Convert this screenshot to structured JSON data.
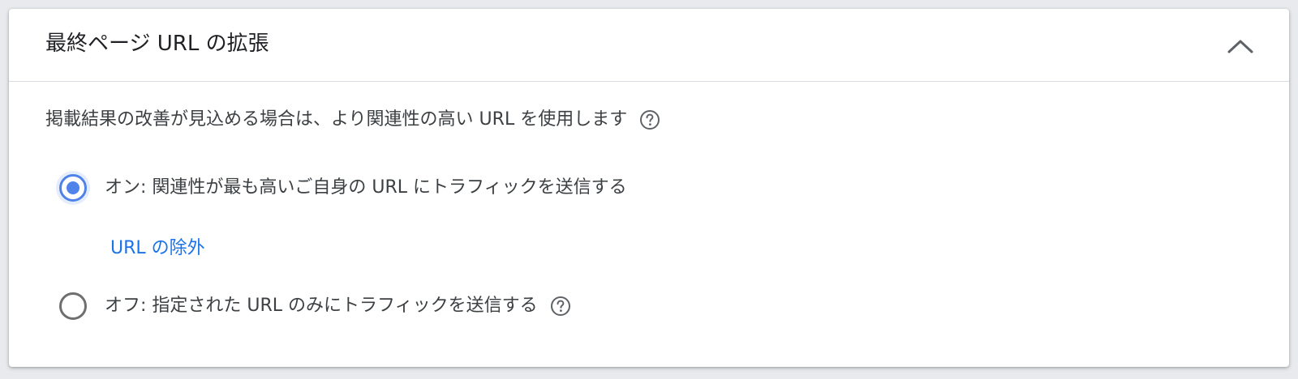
{
  "section": {
    "title": "最終ページ URL の拡張",
    "collapse_icon": "chevron-up-icon"
  },
  "description": {
    "text": "掲載結果の改善が見込める場合は、より関連性の高い URL を使用します",
    "help_icon": "help-circle-icon"
  },
  "options": [
    {
      "label": "オン: 関連性が最も高いご自身の URL にトラフィックを送信する",
      "checked": true
    },
    {
      "label": "オフ: 指定された URL のみにトラフィックを送信する",
      "checked": false
    }
  ],
  "exclude_link": {
    "label": "URL の除外"
  },
  "colors": {
    "accent": "#4f83ea",
    "link": "#1a73e8",
    "text": "#3c4043",
    "divider": "#dadce0"
  }
}
